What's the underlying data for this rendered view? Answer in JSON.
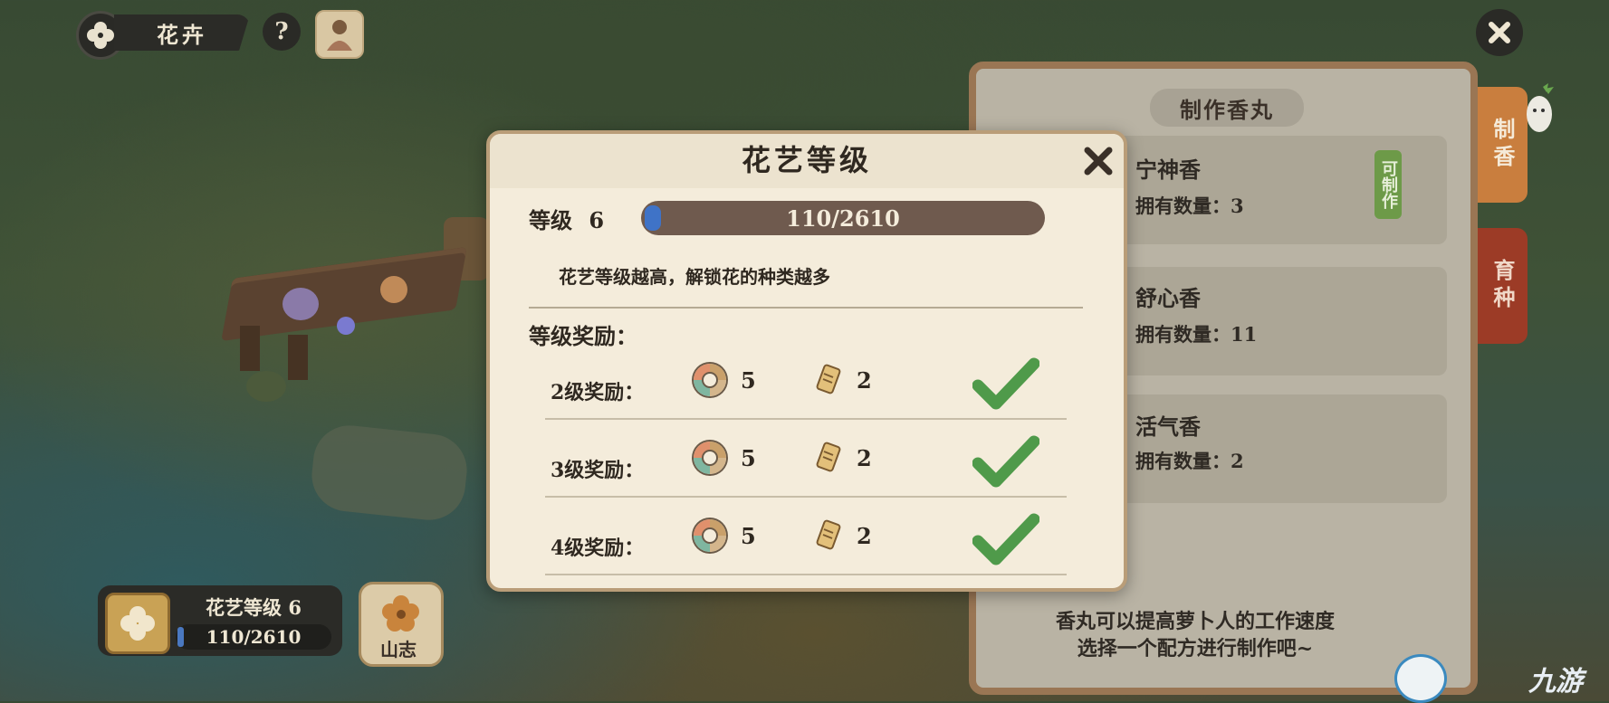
{
  "top_bar": {
    "section_label": "花卉",
    "help_symbol": "?",
    "icons": [
      "flower-icon",
      "help-icon",
      "character-avatar-icon",
      "close-icon"
    ]
  },
  "modal": {
    "title": "花艺等级",
    "level_label": "等级",
    "level_value": "6",
    "xp_text": "110/2610",
    "xp_fraction": 0.042,
    "description": "花艺等级越高，解锁花的种类越多",
    "rewards_header": "等级奖励：",
    "rewards": [
      {
        "label": "2级奖励：",
        "coin_count": "5",
        "scroll_count": "2",
        "claimed": true
      },
      {
        "label": "3级奖励：",
        "coin_count": "5",
        "scroll_count": "2",
        "claimed": true
      },
      {
        "label": "4级奖励：",
        "coin_count": "5",
        "scroll_count": "2",
        "claimed": true
      }
    ]
  },
  "incense_panel": {
    "title": "制作香丸",
    "recipes": [
      {
        "name": "宁神香",
        "count_label": "拥有数量：3",
        "can_make": "可制作"
      },
      {
        "name": "舒心香",
        "count_label": "拥有数量：11"
      },
      {
        "name": "活气香",
        "count_label": "拥有数量：2"
      }
    ],
    "tip_line1": "香丸可以提高萝卜人的工作速度",
    "tip_line2": "选择一个配方进行制作吧~",
    "side_tabs": [
      "制香",
      "育种"
    ]
  },
  "bottom_left": {
    "title": "花艺等级  6",
    "xp_text": "110/2610",
    "journal_label": "山志"
  },
  "watermark": {
    "text": "九游"
  },
  "colors": {
    "modal_bg": "#f4ecdb",
    "xp_bar": "#6f5a4e",
    "xp_fill": "#3f73c7",
    "check_green": "#4f9a4a",
    "tab_orange": "#c97e3e",
    "tab_red": "#9c3b26"
  }
}
